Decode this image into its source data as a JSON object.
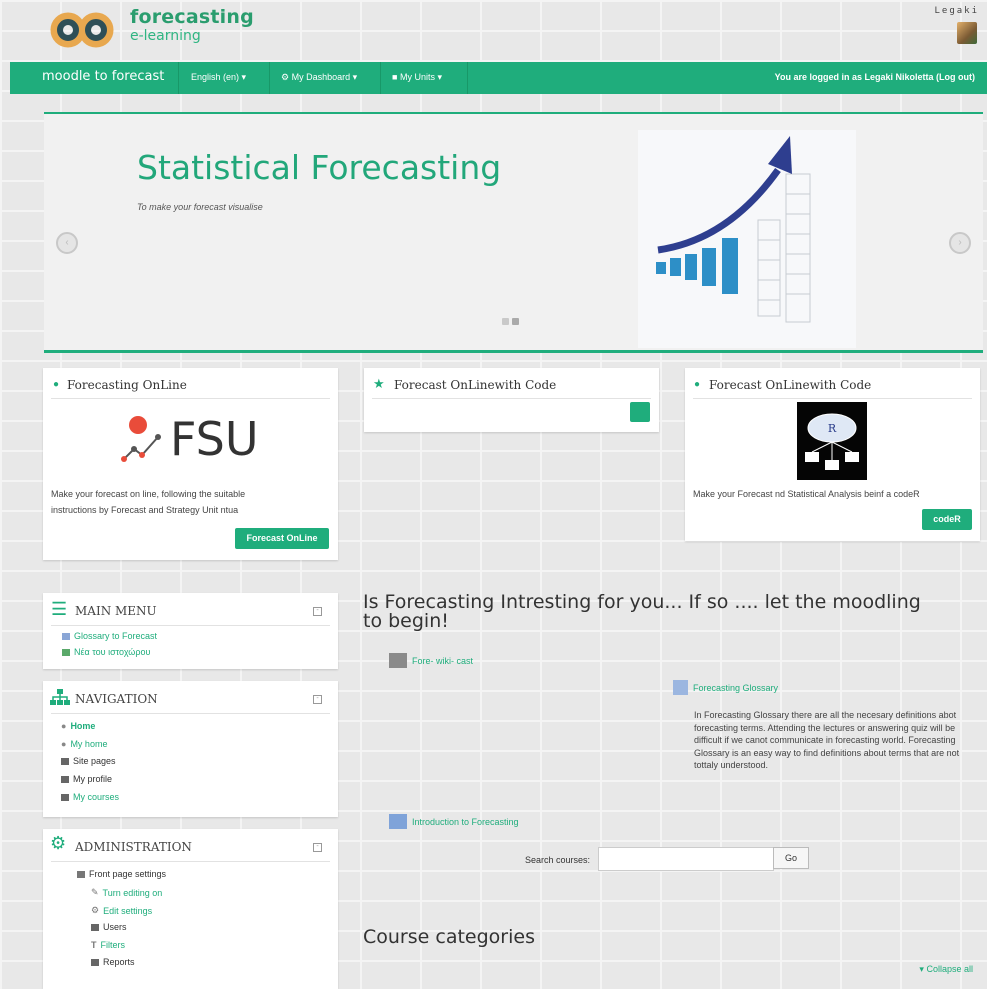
{
  "header": {
    "logo_title": "forecasting",
    "logo_subtitle": "e-learning",
    "user_name": "Legaki"
  },
  "navbar": {
    "brand": "moodle to forecast",
    "items": [
      "English (en)",
      "My Dashboard",
      "My Units"
    ],
    "login_info": "You are logged in as Legaki Nikoletta (Log out)"
  },
  "slider": {
    "title": "Statistical Forecasting",
    "caption": "To make your forecast visualise"
  },
  "blocks": [
    {
      "title": "Forecasting OnLine",
      "logo_text": "FSU",
      "text": "Make your forecast on line, following the suitable instructions by Forecast and Strategy Unit ntua",
      "button": "Forecast OnLine"
    },
    {
      "title": "Forecast OnLinewith Code"
    },
    {
      "title": "Forecast OnLinewith Code",
      "image_letter": "R",
      "text": "Make your Forecast nd Statistical Analysis beinf a codeR",
      "button": "codeR"
    }
  ],
  "main_menu": {
    "title": "MAIN MENU",
    "items": [
      "Glossary to Forecast",
      "Νέα του ιστοχώρου"
    ]
  },
  "navigation": {
    "title": "NAVIGATION",
    "items": [
      "Home",
      "My home",
      "Site pages",
      "My profile",
      "My courses"
    ]
  },
  "administration": {
    "title": "ADMINISTRATION",
    "items": [
      "Front page settings",
      "Turn editing on",
      "Edit settings",
      "Users",
      "Filters",
      "Reports"
    ]
  },
  "main": {
    "heading": "Is Forecasting Intresting for you... If so .... let the moodling to begin!",
    "activities": [
      "Fore- wiki- cast",
      "Forecasting Glossary",
      "Introduction to Forecasting"
    ],
    "glossary_description": "In Forecasting Glossary there are all the necesary definitions abot forecasting terms. Attending the lectures or answering quiz will be difficult if we canot communicate in forecasting world. Forecasting Glossary is an easy way to find definitions about terms that are not tottaly understood.",
    "search_label": "Search courses:",
    "search_value": "",
    "search_button": "Go",
    "categories_heading": "Course categories",
    "collapse_all": "Collapse all"
  },
  "colors": {
    "accent": "#1fad7c",
    "brand_dark": "#2a9d6e"
  }
}
